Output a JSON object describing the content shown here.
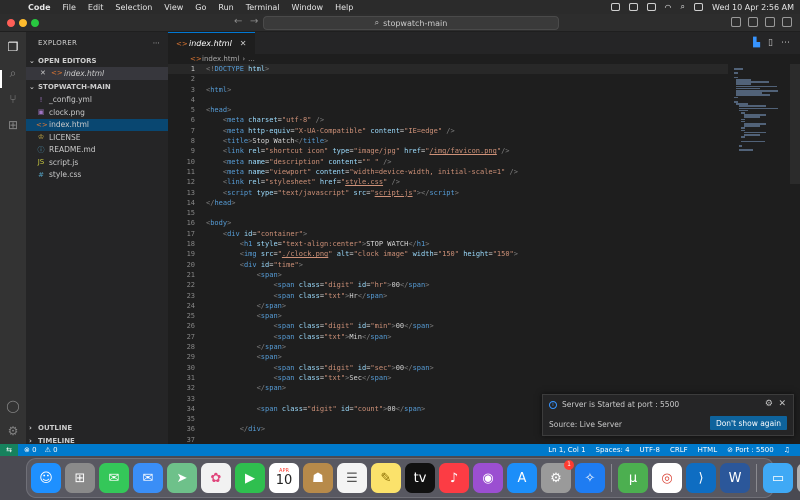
{
  "menubar": {
    "app_name": "Code",
    "items": [
      "File",
      "Edit",
      "Selection",
      "View",
      "Go",
      "Run",
      "Terminal",
      "Window",
      "Help"
    ],
    "datetime": "Wed 10 Apr  2:56 AM"
  },
  "titlebar": {
    "command_center": "stopwatch-main"
  },
  "sidebar": {
    "title": "EXPLORER",
    "open_editors_label": "OPEN EDITORS",
    "open_editor_file": "index.html",
    "folder_label": "STOPWATCH-MAIN",
    "files": [
      {
        "name": "_config.yml",
        "icon": "yml"
      },
      {
        "name": "clock.png",
        "icon": "png"
      },
      {
        "name": "index.html",
        "icon": "html"
      },
      {
        "name": "LICENSE",
        "icon": "license"
      },
      {
        "name": "README.md",
        "icon": "md"
      },
      {
        "name": "script.js",
        "icon": "js"
      },
      {
        "name": "style.css",
        "icon": "css"
      }
    ],
    "outline_label": "OUTLINE",
    "timeline_label": "TIMELINE"
  },
  "editor": {
    "tab_label": "index.html",
    "breadcrumb_file": "index.html",
    "breadcrumb_more": "...",
    "current_line": 1
  },
  "notification": {
    "message": "Server is Started at port : 5500",
    "source": "Source: Live Server",
    "button": "Don't show again"
  },
  "statusbar": {
    "errors": "0",
    "warnings": "0",
    "position": "Ln 1, Col 1",
    "spaces": "Spaces: 4",
    "encoding": "UTF-8",
    "eol": "CRLF",
    "language": "HTML",
    "port": "Port : 5500"
  },
  "dock": {
    "calendar_month": "APR",
    "calendar_day": "10",
    "settings_badge": "1"
  },
  "colors": {
    "accent": "#007acc",
    "tag": "#569cd6",
    "attribute": "#9cdcfe",
    "string": "#ce9178"
  }
}
